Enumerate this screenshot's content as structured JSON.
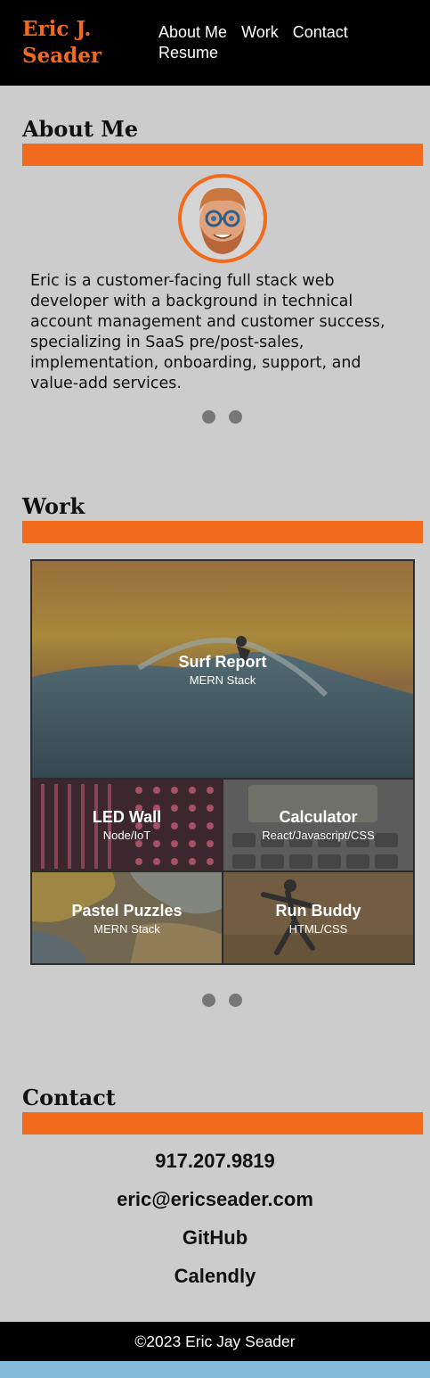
{
  "header": {
    "brand": "Eric J. Seader",
    "nav": [
      "About Me",
      "Work",
      "Contact",
      "Resume"
    ]
  },
  "about": {
    "title": "About Me",
    "bio": "Eric is a customer-facing full stack web developer with a background in technical account management and customer success, specializing in SaaS pre/post-sales, implementation, onboarding, support, and value-add services."
  },
  "work": {
    "title": "Work",
    "projects": [
      {
        "name": "Surf Report",
        "stack": "MERN Stack"
      },
      {
        "name": "LED Wall",
        "stack": "Node/IoT"
      },
      {
        "name": "Calculator",
        "stack": "React/Javascript/CSS"
      },
      {
        "name": "Pastel Puzzles",
        "stack": "MERN Stack"
      },
      {
        "name": "Run Buddy",
        "stack": "HTML/CSS"
      }
    ]
  },
  "contact": {
    "title": "Contact",
    "phone": "917.207.9819",
    "email": "eric@ericseader.com",
    "github": "GitHub",
    "calendly": "Calendly"
  },
  "footer": {
    "copyright": "©2023 Eric Jay Seader"
  },
  "colors": {
    "accent": "#f26a1b",
    "background": "#cccccc",
    "header": "#000000",
    "bottom_strip": "#84b9d9"
  }
}
